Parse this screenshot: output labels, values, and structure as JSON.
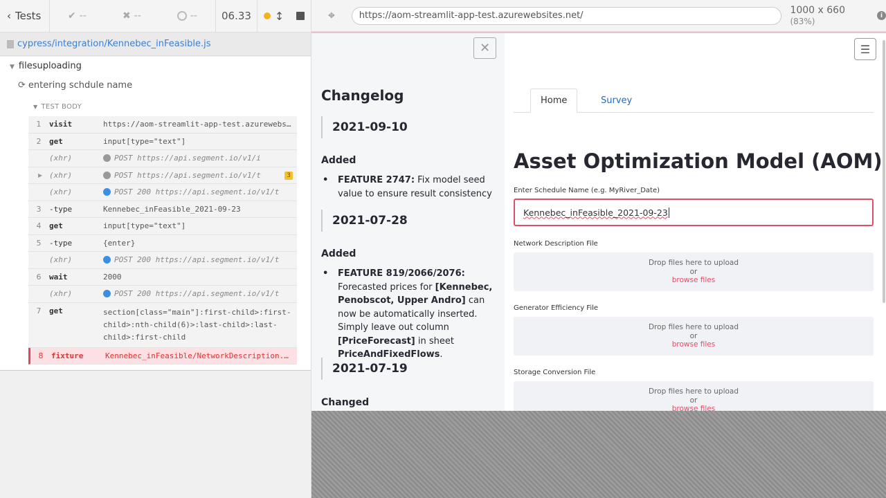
{
  "runner": {
    "tests_label": "Tests",
    "passed": "--",
    "failed": "--",
    "pending": "--",
    "duration": "06.33",
    "spec_file": "cypress/integration/Kennebec_inFeasible.js",
    "suite": "filesuploading",
    "test": "entering schdule name",
    "test_body_label": "TEST BODY",
    "commands": [
      {
        "num": "1",
        "name": "visit",
        "msg": "https://aom-streamlit-app-test.azurewebsites.net/"
      },
      {
        "num": "2",
        "name": "get",
        "msg": "input[type=\"text\"]"
      },
      {
        "num": "",
        "name": "(xhr)",
        "msg": "POST https://api.segment.io/v1/i"
      },
      {
        "num": "",
        "name": "(xhr)",
        "msg": "POST https://api.segment.io/v1/t",
        "badge": "3"
      },
      {
        "num": "",
        "name": "(xhr)",
        "msg": "POST 200 https://api.segment.io/v1/t"
      },
      {
        "num": "3",
        "name": "-type",
        "msg": "Kennebec_inFeasible_2021-09-23"
      },
      {
        "num": "4",
        "name": "get",
        "msg": "input[type=\"text\"]"
      },
      {
        "num": "5",
        "name": "-type",
        "msg": "{enter}"
      },
      {
        "num": "",
        "name": "(xhr)",
        "msg": "POST 200 https://api.segment.io/v1/t"
      },
      {
        "num": "6",
        "name": "wait",
        "msg": "2000"
      },
      {
        "num": "",
        "name": "(xhr)",
        "msg": "POST 200 https://api.segment.io/v1/t"
      },
      {
        "num": "7",
        "name": "get",
        "msg": "section[class=\"main\"]:first-child>:first-child>:nth-child(6)>:last-child>:last-child>:first-child"
      },
      {
        "num": "8",
        "name": "fixture",
        "msg": "Kennebec_inFeasible/NetworkDescription.xlsx"
      }
    ]
  },
  "aut": {
    "url": "https://aom-streamlit-app-test.azurewebsites.net/",
    "viewport": "1000 x 660",
    "scale": "(83%)"
  },
  "sidebar": {
    "title": "Changelog",
    "entries": [
      {
        "date": "2021-09-10",
        "section": "Added",
        "item_bold": "FEATURE 2747:",
        "item_text": " Fix model seed value to ensure result consistency"
      },
      {
        "date": "2021-07-28",
        "section": "Added",
        "item_bold": "FEATURE 819/2066/2076:",
        "item_text": " Forecasted prices for "
      },
      {
        "date": "2021-07-19",
        "section": "Changed"
      }
    ],
    "item2_part_bold1": "[Kennebec, Penobscot, Upper Andro]",
    "item2_part2": " can now be automatically inserted. Simply leave out column ",
    "item2_part_bold2": "[PriceForecast]",
    "item2_part3": " in sheet ",
    "item2_part_bold3": "PriceAndFixedFlows",
    "item2_part4": "."
  },
  "main": {
    "tabs": [
      "Home",
      "Survey"
    ],
    "title": "Asset Optimization Model (AOM)",
    "schedule_label": "Enter Schedule Name (e.g. MyRiver_Date)",
    "schedule_value": "Kennebec_inFeasible_2021-09-23",
    "uploaders": [
      {
        "label": "Network Description File",
        "drop": "Drop files here to upload",
        "or": "or",
        "browse": "browse files"
      },
      {
        "label": "Generator Efficiency File",
        "drop": "Drop files here to upload",
        "or": "or",
        "browse": "browse files"
      },
      {
        "label": "Storage Conversion File",
        "drop": "Drop files here to upload",
        "or": "or",
        "browse": "browse files"
      }
    ]
  }
}
